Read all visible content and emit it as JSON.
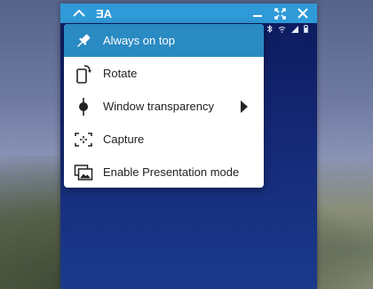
{
  "titlebar": {
    "title": "ƎA",
    "icons": [
      "chevron-up-icon",
      "minimize-icon",
      "fullscreen-icon",
      "close-icon"
    ]
  },
  "status_bar_icons": [
    "bluetooth-icon",
    "wifi-icon",
    "signal-icon",
    "battery-icon"
  ],
  "menu": {
    "items": [
      {
        "label": "Always on top",
        "icon": "pin-icon",
        "selected": true
      },
      {
        "label": "Rotate",
        "icon": "rotate-icon"
      },
      {
        "label": "Window transparency",
        "icon": "transparency-icon",
        "has_submenu": true
      },
      {
        "label": "Capture",
        "icon": "capture-icon"
      },
      {
        "label": "Enable Presentation mode",
        "icon": "presentation-icon"
      }
    ]
  },
  "colors": {
    "titlebar": "#2f9ad8",
    "selected_item": "#2a8ac2",
    "window_bg": "#142875"
  }
}
